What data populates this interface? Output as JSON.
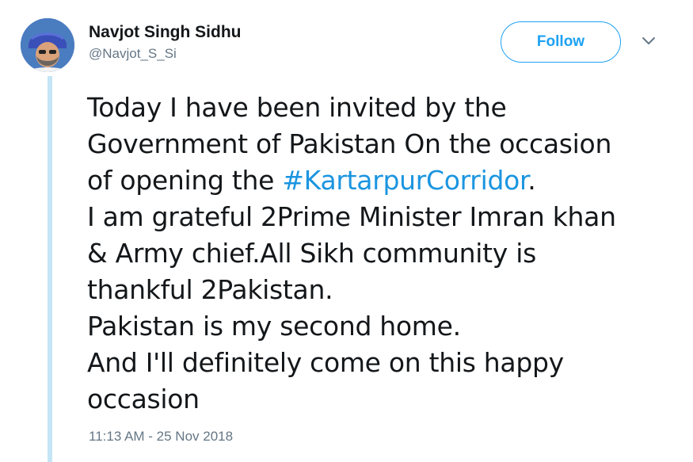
{
  "author": {
    "name": "Navjot Singh Sidhu",
    "handle": "@Navjot_S_Si"
  },
  "follow_button": {
    "label": "Follow"
  },
  "menu_icon": "chevron-down-icon",
  "tweet": {
    "lines": {
      "l1": "Today I have been invited by the",
      "l2": "Government of Pakistan On the occasion",
      "l3_pre": "of opening the ",
      "l3_tag": "#KartarpurCorridor",
      "l3_post": ".",
      "l4": "I am grateful 2Prime Minister Imran khan",
      "l5": "& Army chief.All Sikh community is",
      "l6": "thankful 2Pakistan.",
      "l7": "Pakistan is my second home.",
      "l8": "And I'll definitely come on this happy",
      "l9": "occasion"
    }
  },
  "timestamp": "11:13 AM - 25 Nov 2018",
  "colors": {
    "accent": "#1da1f2",
    "hashtag": "#1b95e0",
    "thread_line": "#c4e5f6",
    "secondary_text": "#657786"
  }
}
